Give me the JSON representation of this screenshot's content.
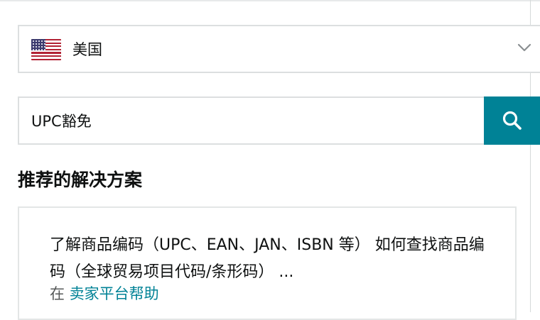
{
  "country_select": {
    "selected": "美国",
    "flag_icon": "us-flag-icon"
  },
  "search": {
    "value": "UPC豁免",
    "icon": "search-icon"
  },
  "recommendations": {
    "heading": "推荐的解决方案",
    "results": [
      {
        "title": "了解商品编码（UPC、EAN、JAN、ISBN 等） 如何查找商品编码（全球贸易项目代码/条形码） ...",
        "source_prefix": "在",
        "source_link": "卖家平台帮助"
      }
    ]
  },
  "colors": {
    "accent": "#008296",
    "border": "#dcdfe0",
    "text": "#0f1111"
  }
}
